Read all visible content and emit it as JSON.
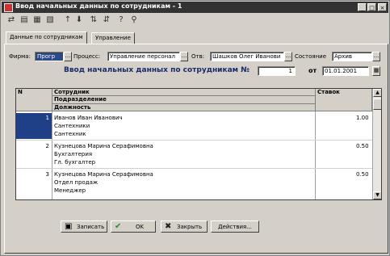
{
  "window": {
    "title": "Ввод начальных данных по сотрудникам - 1",
    "controls": {
      "minimize": "_",
      "maximize": "□",
      "close": "×"
    }
  },
  "toolbar": {
    "icons": [
      "new-doc-icon",
      "copy-doc-icon",
      "edit-doc-icon",
      "delete-doc-icon",
      "move-up-icon",
      "move-down-icon",
      "sort-asc-icon",
      "sort-desc-icon",
      "help-icon",
      "filter-icon"
    ]
  },
  "tabs": [
    {
      "label": "Данные по сотрудникам",
      "active": true
    },
    {
      "label": "Управление",
      "active": false
    }
  ],
  "header_fields": {
    "firm_label": "Фирма:",
    "firm_value": "Прогр",
    "process_label": "Процесс:",
    "process_value": "Управление персонал",
    "resp_label": "Отв:",
    "resp_value": "Шашков Олег Иванови",
    "state_label": "Состояние",
    "state_value": "Архив",
    "dots": "..."
  },
  "doc": {
    "heading": "Ввод начальных данных по сотрудникам №",
    "number": "1",
    "date_prefix": "от",
    "date": "01.01.2001"
  },
  "grid": {
    "headers": {
      "n": "N",
      "employee": "Сотрудник",
      "department": "Подразделение",
      "position": "Должность",
      "rate": "Ставок"
    },
    "rows": [
      {
        "n": "1",
        "employee": "Иванов Иван Иванович",
        "department": "Сантехники",
        "position": "Сантехник",
        "rate": "1.00"
      },
      {
        "n": "2",
        "employee": "Кузнецова Марина Серафимовна",
        "department": "Бухгалтерия",
        "position": "Гл. бухгалтер",
        "rate": "0.50"
      },
      {
        "n": "3",
        "employee": "Кузнецова Марина Серафимовна",
        "department": "Отдел продаж",
        "position": "Менеджер",
        "rate": "0.50"
      }
    ]
  },
  "buttons": {
    "save": "Записать",
    "ok": "OK",
    "close": "Закрыть",
    "actions": "Действия..."
  }
}
